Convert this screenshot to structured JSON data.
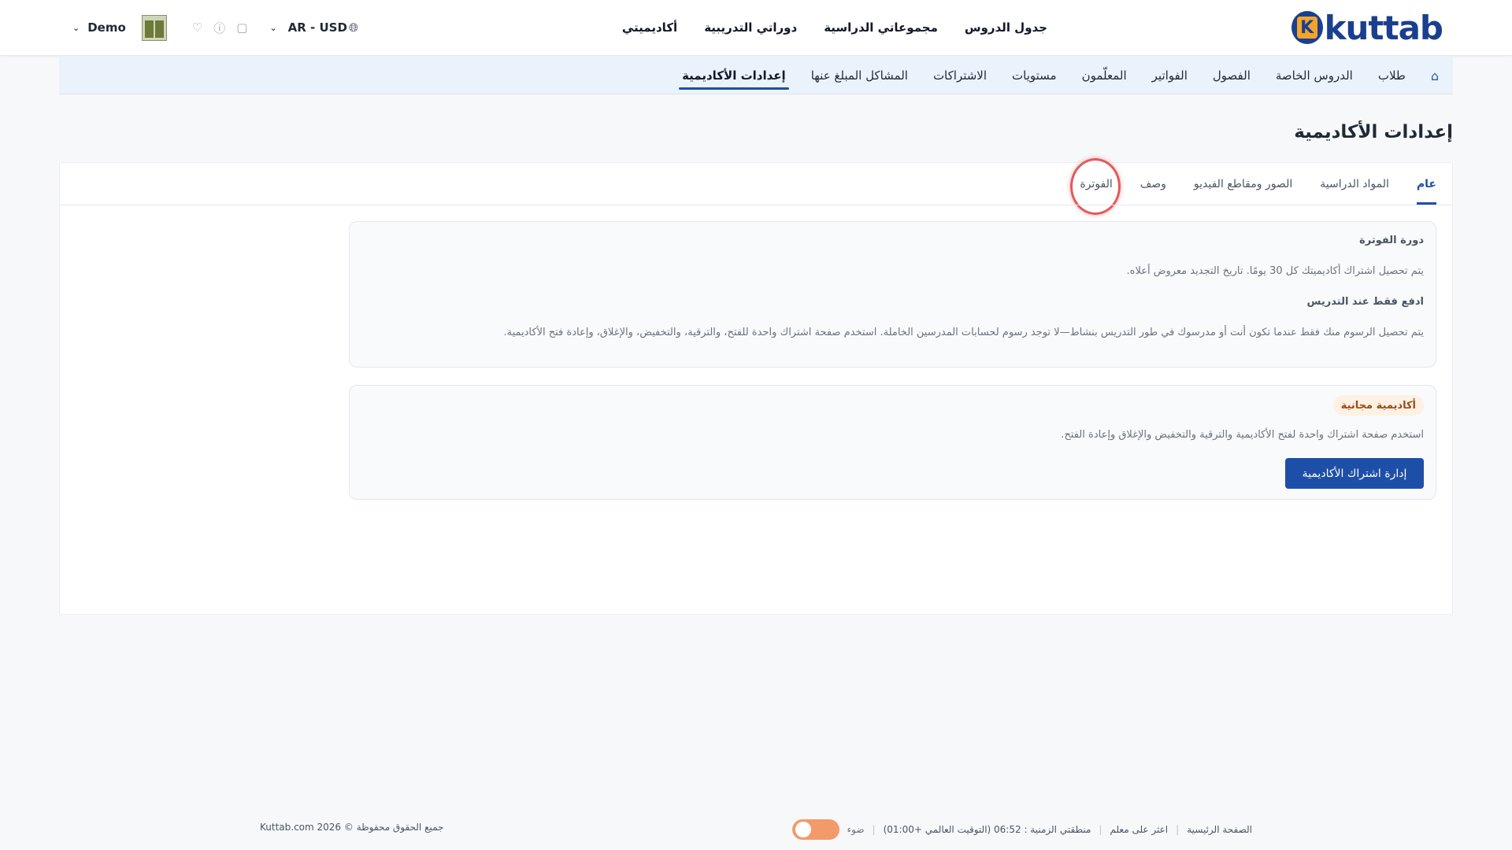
{
  "logo": {
    "badge_letter": "K",
    "text": "kuttab"
  },
  "topnav": {
    "items": [
      "جدول الدروس",
      "مجموعاتي الدراسية",
      "دوراتي التدريبية",
      "أكاديميتي"
    ]
  },
  "top_left": {
    "currency": "AR - USD",
    "user_name": "Demo",
    "icons": [
      "globe-icon",
      "chevron-down-icon",
      "chat-icon",
      "help-icon",
      "heart-icon"
    ]
  },
  "subnav": {
    "items": [
      "طلاب",
      "الدروس الخاصة",
      "الفصول",
      "الفواتير",
      "المعلّمون",
      "مستويات",
      "الاشتراكات",
      "المشاكل المبلغ عنها",
      "إعدادات الأكاديمية"
    ],
    "active_index": 8
  },
  "page": {
    "title": "إعدادات الأكاديمية"
  },
  "tabs": {
    "items": [
      "عام",
      "المواد الدراسية",
      "الصور ومقاطع الفيديو",
      "وصف",
      "الفوترة"
    ],
    "active_index": 0
  },
  "billing_box": {
    "heading1": "دورة الفوترة",
    "text1": "يتم تحصيل اشتراك أكاديميتك كل 30 يومًا. تاريخ التجديد معروض أعلاه.",
    "heading2": "ادفع فقط عند التدريس",
    "text2": "يتم تحصيل الرسوم منك فقط عندما تكون أنت أو مدرسوك في طور التدريس بنشاط—لا توجد رسوم لحسابات المدرسين الخاملة. استخدم صفحة اشتراك واحدة للفتح، والترقية، والتخفيض، والإغلاق، وإعادة فتح الأكاديمية."
  },
  "free_box": {
    "badge": "أكاديمية مجانية",
    "text": "استخدم صفحة اشتراك واحدة لفتح الأكاديمية والترقية والتخفيض والإغلاق وإعادة الفتح.",
    "button_label": "إدارة اشتراك الأكاديمية"
  },
  "footer": {
    "copyright": "Kuttab.com 2026 © جميع الحقوق محفوظة",
    "links": [
      "الصفحة الرئيسية",
      "اعثر على معلم",
      "منطقتي الزمنية : 06:52 (التوقيت العالمي +01:00)"
    ],
    "light_label": "ضوء"
  },
  "colors": {
    "primary": "#1e4fa8",
    "brand": "#1b3f8f",
    "accent": "#f3a52b",
    "highlight_circle": "#e25a5a",
    "toggle": "#f39a6b"
  }
}
